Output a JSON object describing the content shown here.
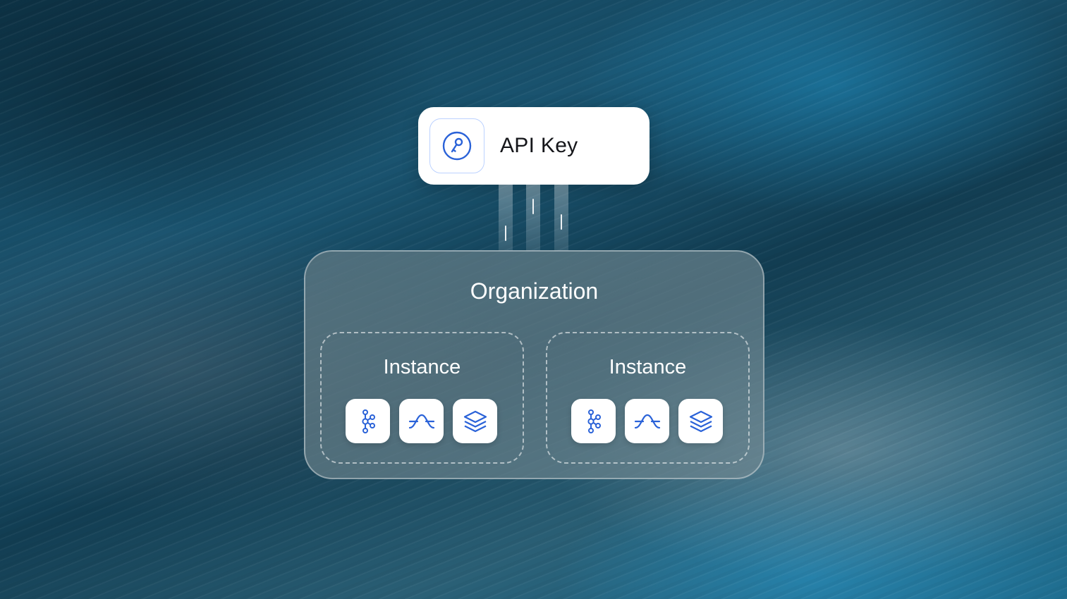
{
  "colors": {
    "accent": "#2a62d8",
    "card_bg": "#ffffff",
    "text_light": "#ffffff",
    "text_dark": "#15161a"
  },
  "api_key": {
    "label": "API Key",
    "icon": "key-icon"
  },
  "organization": {
    "title": "Organization",
    "instances": [
      {
        "title": "Instance",
        "icons": [
          "cluster-nodes-icon",
          "bell-curve-icon",
          "layers-icon"
        ]
      },
      {
        "title": "Instance",
        "icons": [
          "cluster-nodes-icon",
          "bell-curve-icon",
          "layers-icon"
        ]
      }
    ]
  }
}
